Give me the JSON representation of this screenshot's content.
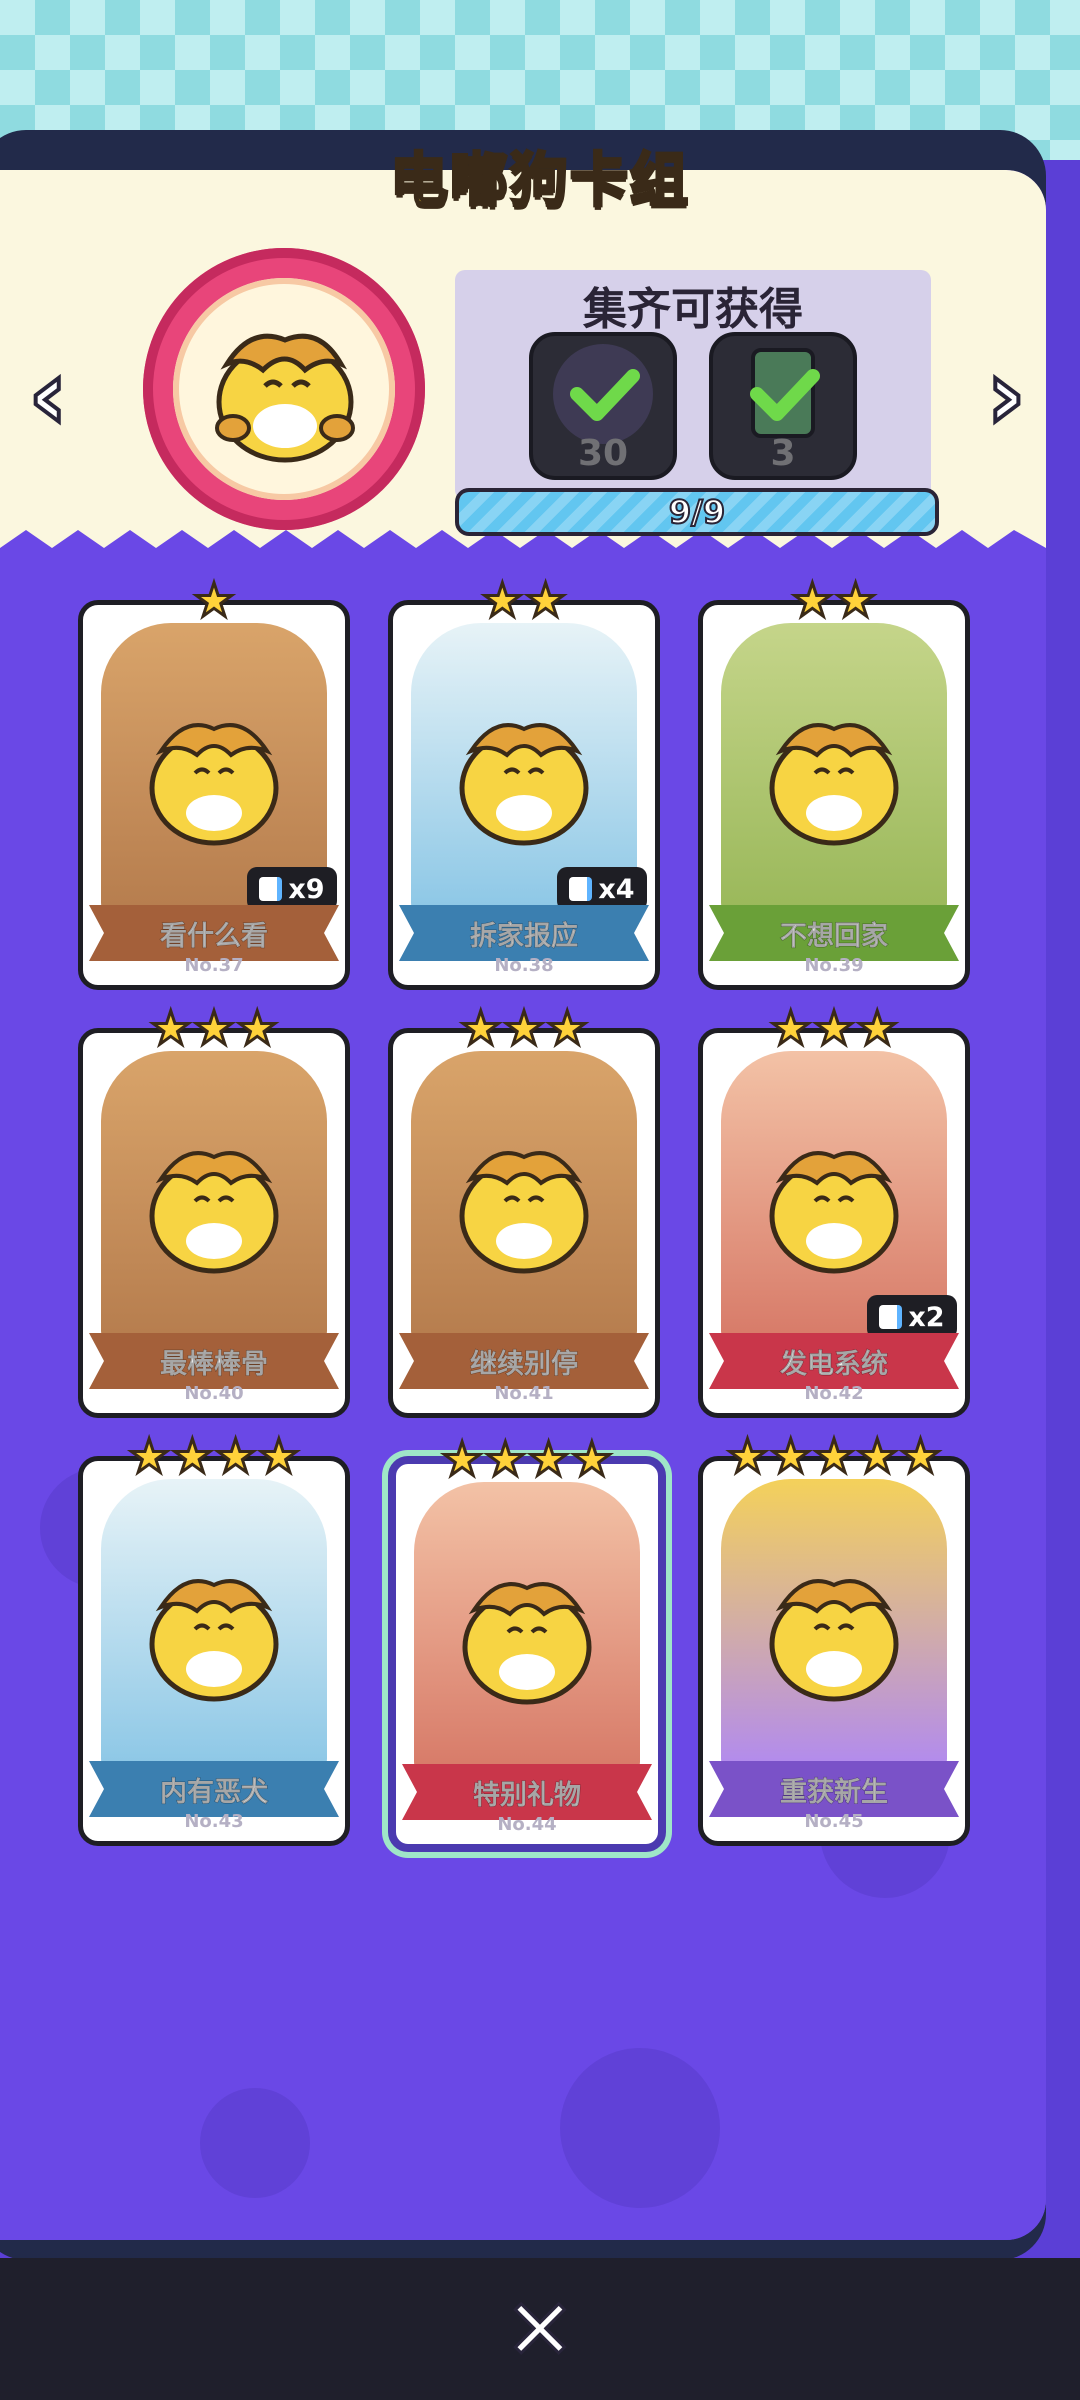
{
  "title": "电嘟狗卡组",
  "rewards": {
    "title": "集齐可获得",
    "items": [
      {
        "count": "30",
        "icon": "check-icon",
        "claimed": true
      },
      {
        "count": "3",
        "icon": "check-icon",
        "claimed": true
      }
    ],
    "progress_text": "9/9",
    "progress_fraction": 1.0
  },
  "cards": [
    {
      "name": "看什么看",
      "number": "No.37",
      "stars": 1,
      "duplicates": "x9",
      "theme": "brown"
    },
    {
      "name": "拆家报应",
      "number": "No.38",
      "stars": 2,
      "duplicates": "x4",
      "theme": "blue"
    },
    {
      "name": "不想回家",
      "number": "No.39",
      "stars": 2,
      "duplicates": "",
      "theme": "green"
    },
    {
      "name": "最棒棒骨",
      "number": "No.40",
      "stars": 3,
      "duplicates": "",
      "theme": "brown"
    },
    {
      "name": "继续别停",
      "number": "No.41",
      "stars": 3,
      "duplicates": "",
      "theme": "brown"
    },
    {
      "name": "发电系统",
      "number": "No.42",
      "stars": 3,
      "duplicates": "x2",
      "theme": "red"
    },
    {
      "name": "内有恶犬",
      "number": "No.43",
      "stars": 4,
      "duplicates": "",
      "theme": "blue"
    },
    {
      "name": "特别礼物",
      "number": "No.44",
      "stars": 4,
      "duplicates": "",
      "theme": "red",
      "special": true
    },
    {
      "name": "重获新生",
      "number": "No.45",
      "stars": 5,
      "duplicates": "",
      "theme": "purple"
    }
  ],
  "colors": {
    "brown": "#a4603a",
    "blue": "#3b7fb0",
    "green": "#6aa038",
    "red": "#c9364a",
    "purple": "#7a52c8",
    "star": "#ffd23a",
    "accent_bg": "#6a48e6"
  }
}
